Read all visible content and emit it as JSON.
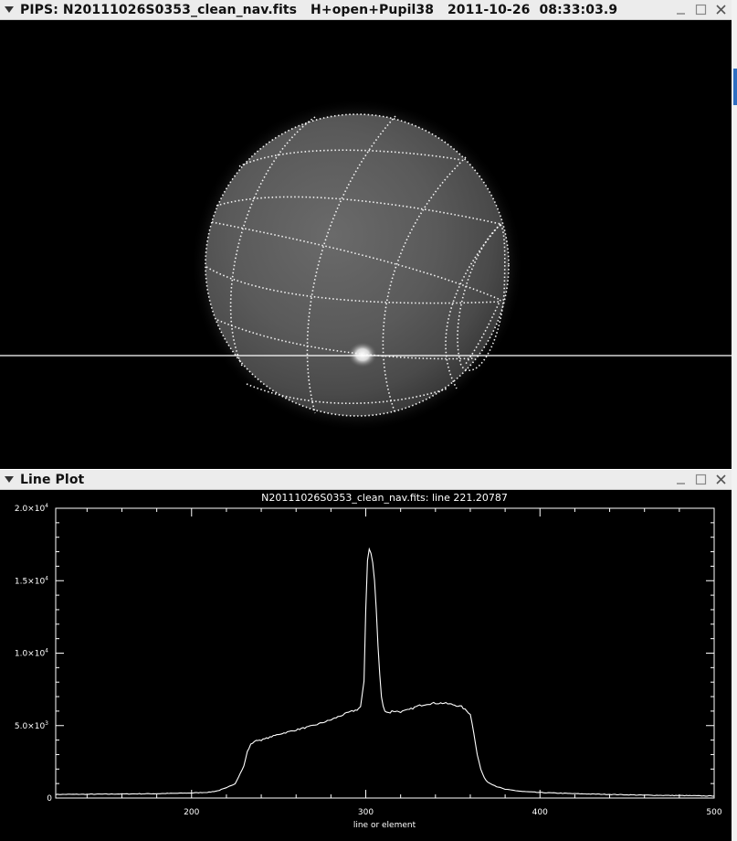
{
  "image_window": {
    "title": "PIPS: N20111026S0353_clean_nav.fits   H+open+Pupil38   2011-10-26  08:33:03.9"
  },
  "plot_window": {
    "title": "Line Plot"
  },
  "chart_data": {
    "type": "line",
    "title": "N20111026S0353_clean_nav.fits: line 221.20787",
    "xlabel": "line or element",
    "ylabel": "",
    "xlim": [
      122,
      500
    ],
    "ylim": [
      0,
      20000
    ],
    "x_ticks": [
      200,
      300,
      400,
      500
    ],
    "x_tick_labels": [
      "200",
      "300",
      "400",
      "500"
    ],
    "y_ticks": [
      0,
      5000,
      10000,
      15000,
      20000
    ],
    "y_tick_labels": [
      {
        "mant": "0",
        "exp": ""
      },
      {
        "mant": "5.0×10",
        "exp": "3"
      },
      {
        "mant": "1.0×10",
        "exp": "4"
      },
      {
        "mant": "1.5×10",
        "exp": "4"
      },
      {
        "mant": "2.0×10",
        "exp": "4"
      }
    ],
    "grid": false,
    "background": "#000000",
    "line_color": "#ffffff",
    "series": [
      {
        "x": [
          122,
          140,
          160,
          180,
          200,
          210,
          215,
          220,
          225,
          230,
          232,
          234,
          236,
          238,
          240,
          245,
          250,
          260,
          270,
          280,
          290,
          295,
          297,
          299,
          300,
          301,
          302,
          303,
          304,
          305,
          306,
          307,
          308,
          309,
          310,
          311,
          312,
          313,
          314,
          315,
          317,
          320,
          325,
          330,
          335,
          340,
          345,
          350,
          355,
          360,
          362,
          364,
          366,
          368,
          370,
          375,
          380,
          390,
          400,
          420,
          440,
          460,
          480,
          500
        ],
        "y": [
          250,
          260,
          280,
          300,
          350,
          400,
          500,
          700,
          1000,
          2200,
          3200,
          3700,
          3900,
          4000,
          4000,
          4200,
          4400,
          4700,
          5000,
          5400,
          5900,
          6100,
          6300,
          8000,
          13000,
          16500,
          17200,
          17000,
          16200,
          15000,
          13000,
          10500,
          8500,
          7000,
          6300,
          6050,
          5950,
          5900,
          5900,
          6000,
          6000,
          5950,
          6100,
          6350,
          6500,
          6550,
          6550,
          6450,
          6300,
          5800,
          4500,
          3000,
          2000,
          1400,
          1100,
          800,
          600,
          450,
          380,
          300,
          250,
          200,
          170,
          140
        ]
      }
    ]
  }
}
